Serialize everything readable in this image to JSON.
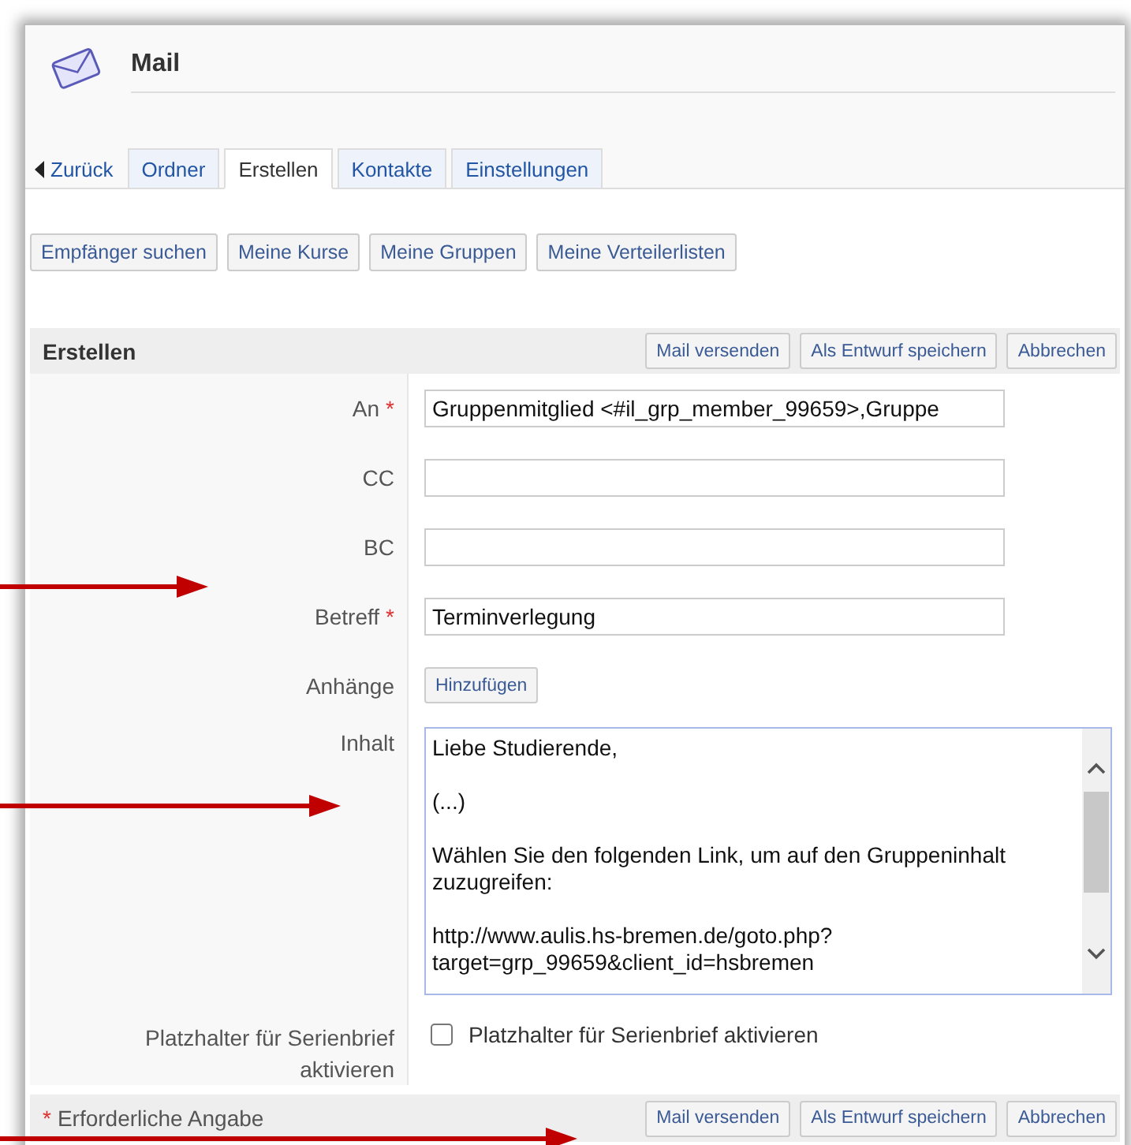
{
  "window": {
    "title": "Mail"
  },
  "back_link": "Zurück",
  "tabs": [
    {
      "label": "Ordner",
      "selected": false
    },
    {
      "label": "Erstellen",
      "selected": true
    },
    {
      "label": "Kontakte",
      "selected": false
    },
    {
      "label": "Einstellungen",
      "selected": false
    }
  ],
  "toolbar": [
    "Empfänger suchen",
    "Meine Kurse",
    "Meine Gruppen",
    "Meine Verteilerlisten"
  ],
  "form": {
    "title": "Erstellen",
    "required_mark": "*",
    "header_buttons": [
      "Mail versenden",
      "Als Entwurf speichern",
      "Abbrechen"
    ],
    "fields": [
      {
        "kind": "text",
        "label": "An",
        "required": true,
        "value": "Gruppenmitglied <#il_grp_member_99659>,Gruppe"
      },
      {
        "kind": "text",
        "label": "CC",
        "required": false
      },
      {
        "kind": "text",
        "label": "BC",
        "required": false
      },
      {
        "kind": "text",
        "label": "Betreff",
        "required": true,
        "value": "Terminverlegung"
      },
      {
        "kind": "button",
        "label": "Anhänge",
        "required": false,
        "button": "Hinzufügen"
      },
      {
        "kind": "textarea",
        "label": "Inhalt",
        "required": false,
        "value": "Liebe Studierende,\n\n(...)\n\nWählen Sie den folgenden Link, um auf den Gruppeninhalt zuzugreifen:\n\nhttp://www.aulis.hs-bremen.de/goto.php?\ntarget=grp_99659&client_id=hsbremen"
      },
      {
        "kind": "checkbox",
        "label": "Platzhalter für Serienbrief aktivieren",
        "required": false,
        "option": "Platzhalter für Serienbrief aktivieren",
        "checked": false
      }
    ],
    "footer_note": "Erforderliche Angabe",
    "footer_buttons": [
      "Mail versenden",
      "Als Entwurf speichern",
      "Abbrechen"
    ]
  }
}
